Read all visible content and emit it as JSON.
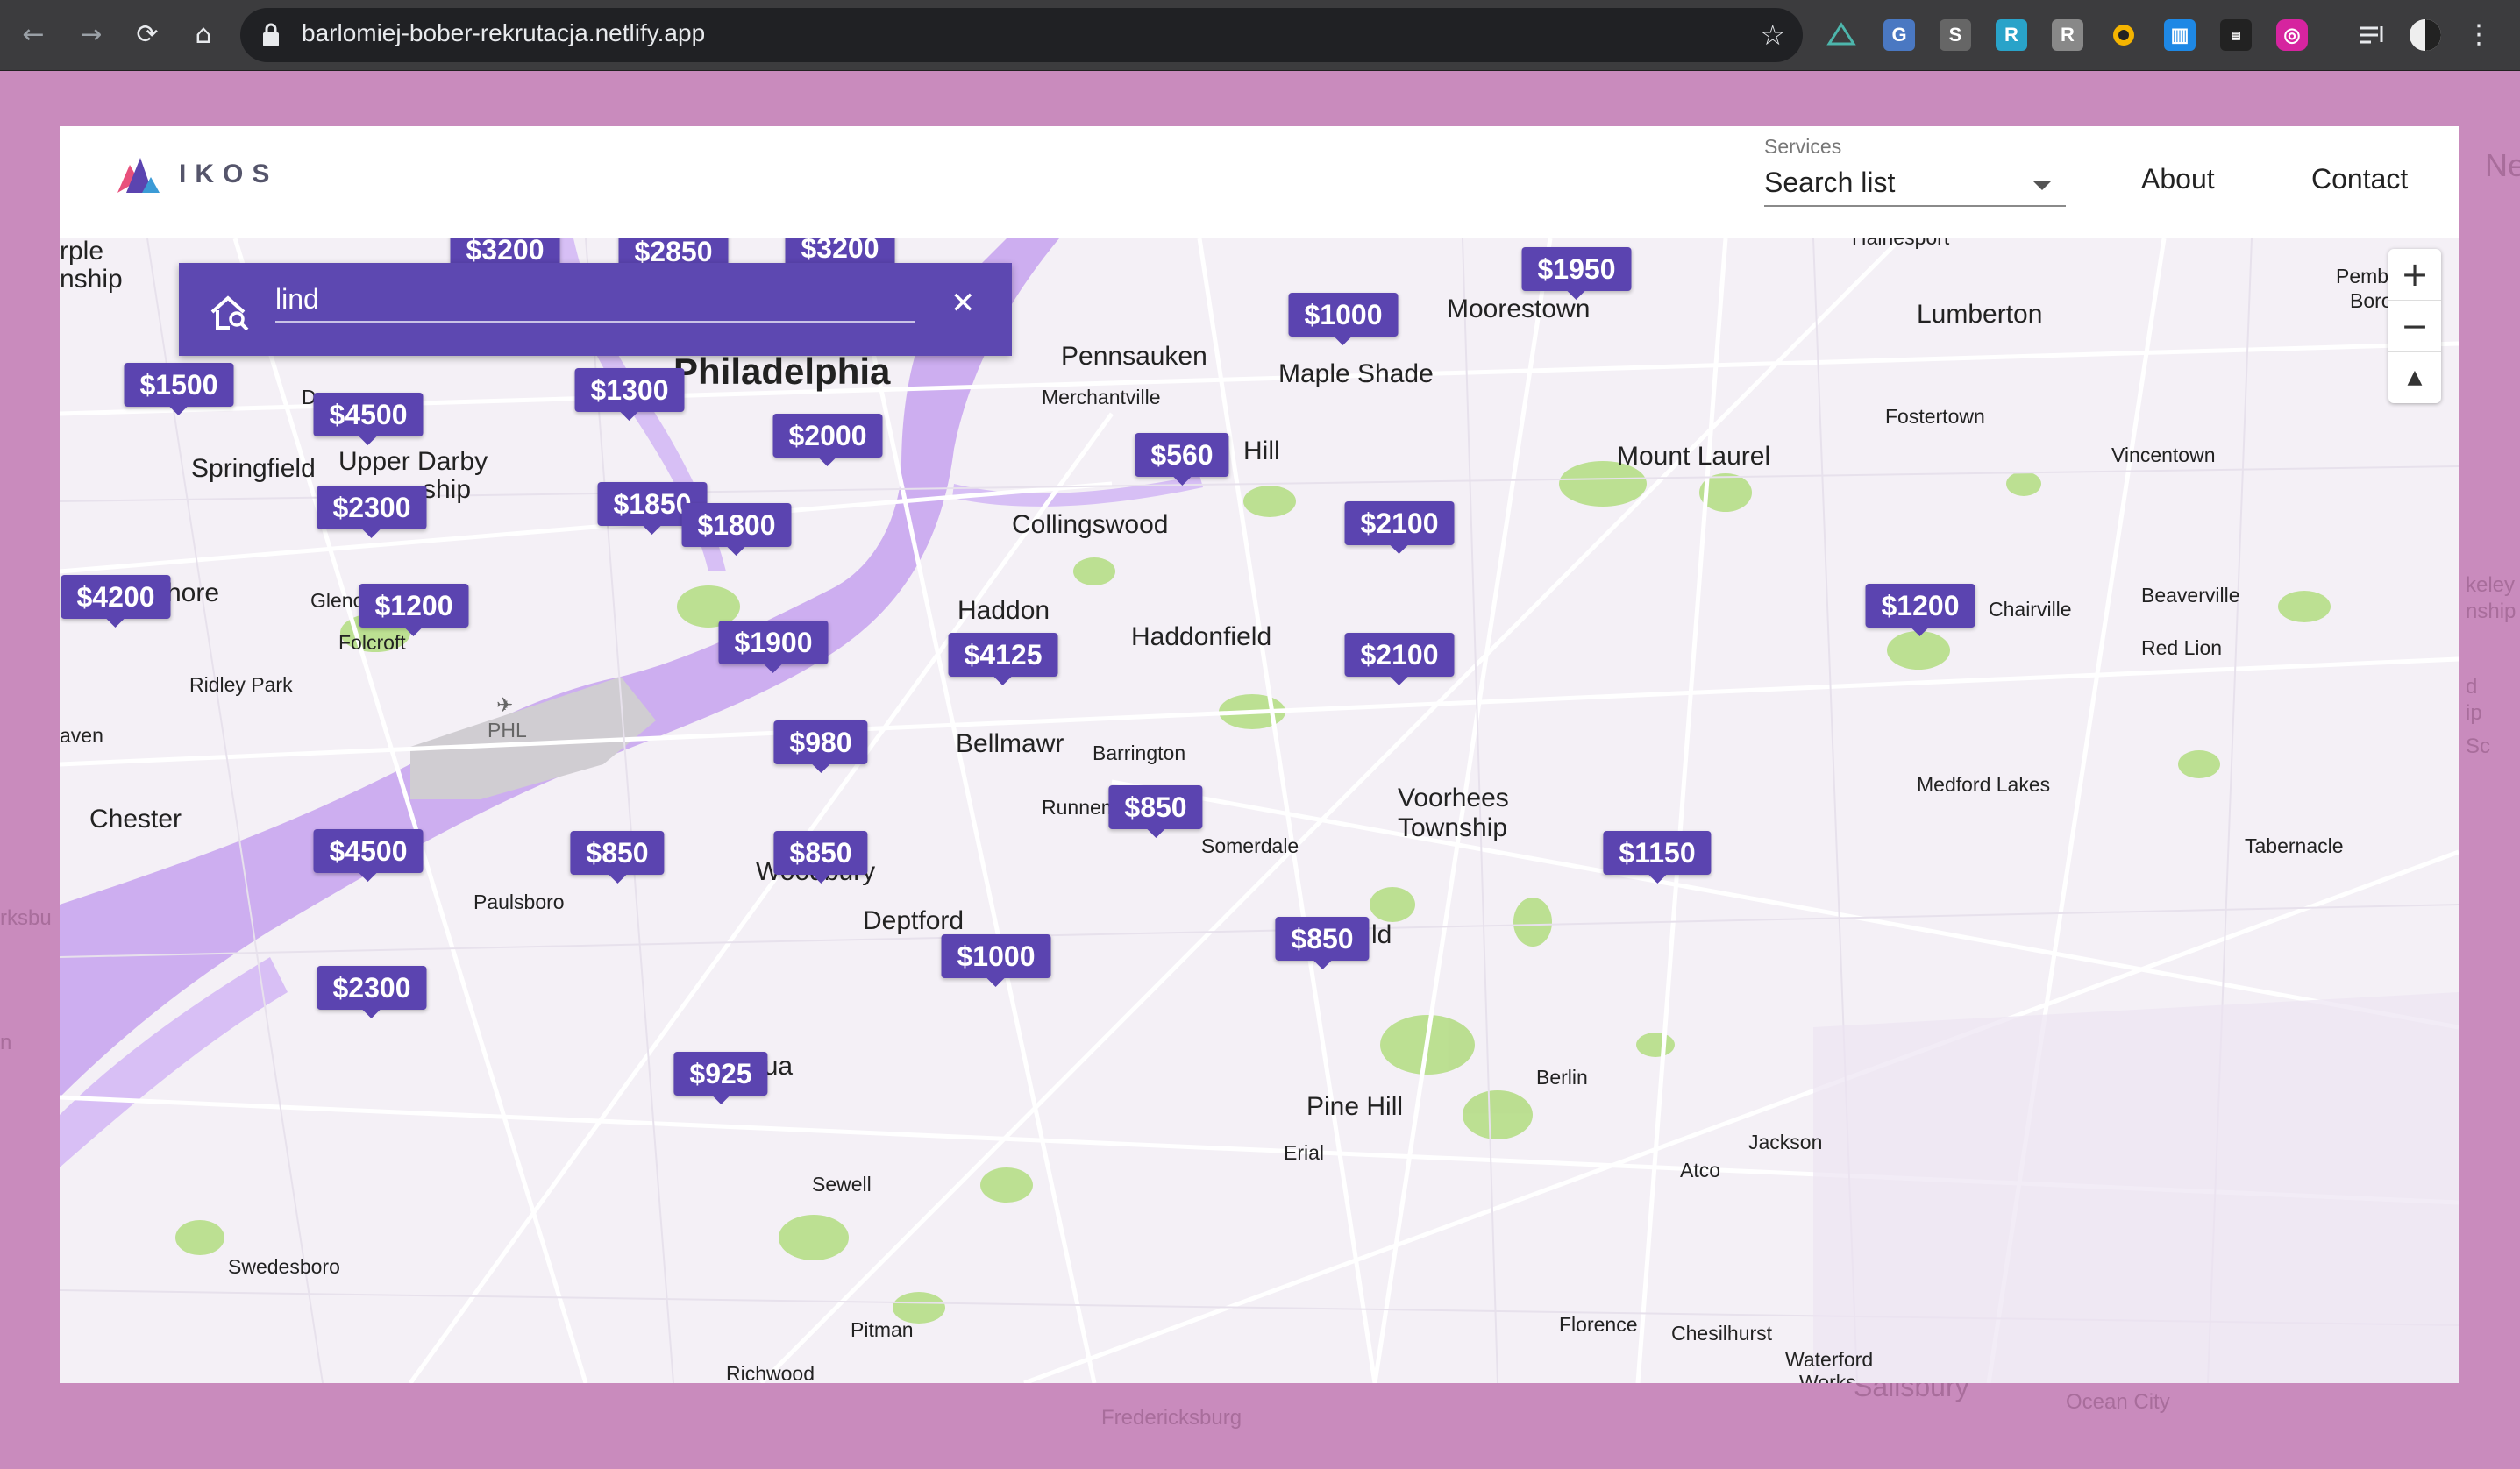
{
  "browser": {
    "url": "barlomiej-bober-rekrutacja.netlify.app"
  },
  "app": {
    "logo_text": "IKOS",
    "services_label": "Services",
    "services_value": "Search list",
    "nav": [
      "About",
      "Contact"
    ]
  },
  "search": {
    "value": "lind"
  },
  "map": {
    "places": [
      {
        "name": "Philadelphia",
        "cls": "city"
      },
      {
        "name": "Pennsauken",
        "cls": "big"
      },
      {
        "name": "Merchantville",
        "cls": "small"
      },
      {
        "name": "Maple Shade",
        "cls": "big"
      },
      {
        "name": "Moorestown",
        "cls": "big"
      },
      {
        "name": "Lumberton",
        "cls": "big"
      },
      {
        "name": "Hainesport",
        "cls": "small"
      },
      {
        "name": "Pemb",
        "cls": "small"
      },
      {
        "name": "Boro",
        "cls": "small"
      },
      {
        "name": "Fostertown",
        "cls": "small"
      },
      {
        "name": "Mount Laurel",
        "cls": "big"
      },
      {
        "name": "Vincentown",
        "cls": "small"
      },
      {
        "name": "Springfield",
        "cls": "big"
      },
      {
        "name": "Upper Darby",
        "cls": "big"
      },
      {
        "name": "Collingswood",
        "cls": "big"
      },
      {
        "name": "Haddon",
        "cls": "big"
      },
      {
        "name": "Haddonfield",
        "cls": "big"
      },
      {
        "name": "Chairville",
        "cls": "small"
      },
      {
        "name": "Beaverville",
        "cls": "small"
      },
      {
        "name": "Red Lion",
        "cls": "small"
      },
      {
        "name": "Folcroft",
        "cls": "small"
      },
      {
        "name": "Ridley Park",
        "cls": "small"
      },
      {
        "name": "PHL",
        "cls": "small dim"
      },
      {
        "name": "Bellmawr",
        "cls": "big"
      },
      {
        "name": "Barrington",
        "cls": "small"
      },
      {
        "name": "Runnem",
        "cls": "small"
      },
      {
        "name": "Somerdale",
        "cls": "small"
      },
      {
        "name": "Voorhees",
        "cls": "big"
      },
      {
        "name": "Township",
        "cls": "big"
      },
      {
        "name": "Medford Lakes",
        "cls": "small"
      },
      {
        "name": "Tabernacle",
        "cls": "small"
      },
      {
        "name": "Chester",
        "cls": "big"
      },
      {
        "name": "Paulsboro",
        "cls": "small"
      },
      {
        "name": "Woodbury",
        "cls": "big"
      },
      {
        "name": "Deptford",
        "cls": "big"
      },
      {
        "name": "Mantua",
        "cls": "big"
      },
      {
        "name": "Pine Hill",
        "cls": "big"
      },
      {
        "name": "Erial",
        "cls": "small"
      },
      {
        "name": "Berlin",
        "cls": "small"
      },
      {
        "name": "Jackson",
        "cls": "small"
      },
      {
        "name": "Atco",
        "cls": "small"
      },
      {
        "name": "Sewell",
        "cls": "small"
      },
      {
        "name": "Swedesboro",
        "cls": "small"
      },
      {
        "name": "Pitman",
        "cls": "small"
      },
      {
        "name": "Richwood",
        "cls": "small"
      },
      {
        "name": "Florence",
        "cls": "small"
      },
      {
        "name": "Chesilhurst",
        "cls": "small"
      },
      {
        "name": "Waterford",
        "cls": "small"
      },
      {
        "name": "Works",
        "cls": "small"
      },
      {
        "name": "rple",
        "cls": "big"
      },
      {
        "name": "nship",
        "cls": "big"
      },
      {
        "name": "D",
        "cls": "small"
      },
      {
        "name": "hore",
        "cls": "big"
      },
      {
        "name": "Glenc",
        "cls": "small"
      },
      {
        "name": "aven",
        "cls": "small"
      },
      {
        "name": "Hill",
        "cls": "big"
      },
      {
        "name": "ld",
        "cls": "big"
      },
      {
        "name": "ship",
        "cls": "big"
      }
    ],
    "pins": [
      "$3200",
      "$2850",
      "$3200",
      "$1950",
      "$1000",
      "$1500",
      "$4500",
      "$1300",
      "$2000",
      "$560",
      "$2300",
      "$1850",
      "$1800",
      "$2100",
      "$4200",
      "$1200",
      "$1200",
      "$1900",
      "$4125",
      "$2100",
      "$980",
      "$850",
      "$4500",
      "$850",
      "$850",
      "$1150",
      "$1000",
      "$850",
      "$2300",
      "$925"
    ]
  },
  "page_background_labels": [
    "Ne",
    "keley",
    "nship",
    "d",
    "ip",
    "Sc",
    "rksbu",
    "n",
    "Salisbury",
    "Fredericksburg",
    "Ocean City"
  ],
  "zoom": {
    "in": "+",
    "out": "−",
    "compass": "▲"
  }
}
